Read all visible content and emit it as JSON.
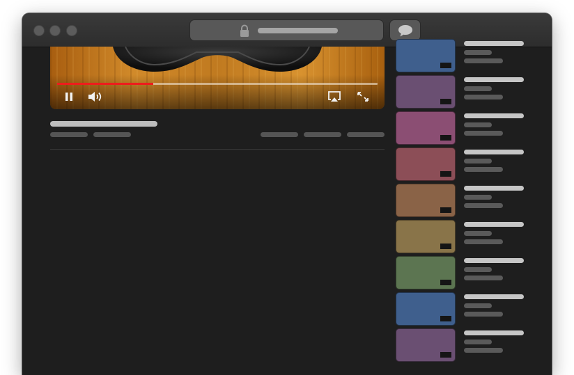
{
  "window": {
    "traffic_lights": [
      "close",
      "minimize",
      "zoom"
    ],
    "address_bar": {
      "icon": "lock-icon",
      "url": ""
    },
    "toolbar_button_icon": "speech-bubble-icon"
  },
  "player": {
    "progress": 0.3,
    "colors": {
      "progress_fill": "#ee1c1c",
      "progress_track": "#e0d5c5"
    },
    "controls": {
      "left": [
        "pause-icon",
        "volume-icon"
      ],
      "right": [
        "airplay-icon",
        "fullscreen-icon"
      ]
    }
  },
  "video_info": {
    "title": "",
    "meta": [
      "",
      ""
    ],
    "actions": [
      "",
      "",
      ""
    ]
  },
  "sidebar": {
    "videos": [
      {
        "color": "#3f5f8d",
        "title": "",
        "channel": "",
        "views": ""
      },
      {
        "color": "#6a4f72",
        "title": "",
        "channel": "",
        "views": ""
      },
      {
        "color": "#8b4e73",
        "title": "",
        "channel": "",
        "views": ""
      },
      {
        "color": "#8c4e57",
        "title": "",
        "channel": "",
        "views": ""
      },
      {
        "color": "#8a6347",
        "title": "",
        "channel": "",
        "views": ""
      },
      {
        "color": "#897449",
        "title": "",
        "channel": "",
        "views": ""
      },
      {
        "color": "#5c7551",
        "title": "",
        "channel": "",
        "views": ""
      },
      {
        "color": "#3f5f8d",
        "title": "",
        "channel": "",
        "views": ""
      },
      {
        "color": "#6a4f72",
        "title": "",
        "channel": "",
        "views": ""
      }
    ]
  }
}
